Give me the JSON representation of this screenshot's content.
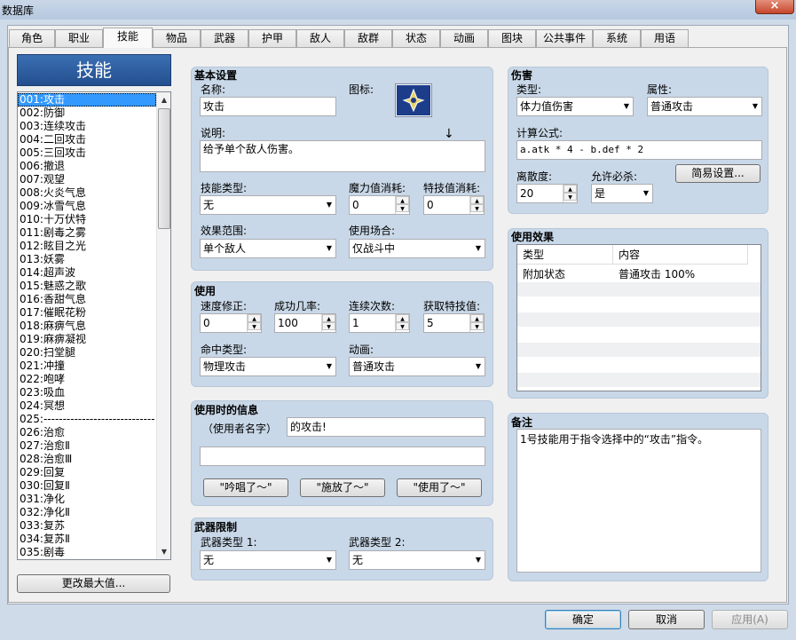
{
  "window": {
    "title": "数据库",
    "close": "×"
  },
  "tabs": [
    {
      "label": "角色"
    },
    {
      "label": "职业"
    },
    {
      "label": "技能"
    },
    {
      "label": "物品"
    },
    {
      "label": "武器"
    },
    {
      "label": "护甲"
    },
    {
      "label": "敌人"
    },
    {
      "label": "敌群"
    },
    {
      "label": "状态"
    },
    {
      "label": "动画"
    },
    {
      "label": "图块"
    },
    {
      "label": "公共事件"
    },
    {
      "label": "系统"
    },
    {
      "label": "用语"
    }
  ],
  "list": {
    "header": "技能",
    "change_max": "更改最大值...",
    "items": [
      "001:攻击",
      "002:防御",
      "003:连续攻击",
      "004:二回攻击",
      "005:三回攻击",
      "006:撤退",
      "007:观望",
      "008:火炎气息",
      "009:冰雪气息",
      "010:十万伏特",
      "011:剧毒之雾",
      "012:眩目之光",
      "013:妖雾",
      "014:超声波",
      "015:魅惑之歌",
      "016:香甜气息",
      "017:催眠花粉",
      "018:麻痹气息",
      "019:麻痹凝视",
      "020:扫堂腿",
      "021:冲撞",
      "022:咆哮",
      "023:吸血",
      "024:冥想",
      "025:-----------------------------",
      "026:治愈",
      "027:治愈Ⅱ",
      "028:治愈Ⅲ",
      "029:回复",
      "030:回复Ⅱ",
      "031:净化",
      "032:净化Ⅱ",
      "033:复苏",
      "034:复苏Ⅱ",
      "035:剧毒"
    ]
  },
  "basic": {
    "title": "基本设置",
    "name_label": "名称:",
    "name": "攻击",
    "icon_label": "图标:",
    "desc_label": "说明:",
    "desc": "给予单个敌人伤害。",
    "type_label": "技能类型:",
    "type": "无",
    "mp_label": "魔力值消耗:",
    "mp": "0",
    "tp_label": "特技值消耗:",
    "tp": "0",
    "scope_label": "效果范围:",
    "scope": "单个敌人",
    "occasion_label": "使用场合:",
    "occasion": "仅战斗中"
  },
  "invocation": {
    "title": "使用",
    "speed_label": "速度修正:",
    "speed": "0",
    "success_label": "成功几率:",
    "success": "100",
    "repeat_label": "连续次数:",
    "repeat": "1",
    "tpgain_label": "获取特技值:",
    "tpgain": "5",
    "hit_label": "命中类型:",
    "hit": "物理攻击",
    "anim_label": "动画:",
    "anim": "普通攻击"
  },
  "message": {
    "title": "使用时的信息",
    "user_label": "（使用者名字）",
    "msg1": "的攻击!",
    "msg2": "",
    "btn1": "\"吟唱了～\"",
    "btn2": "\"施放了～\"",
    "btn3": "\"使用了～\""
  },
  "weapon": {
    "title": "武器限制",
    "w1_label": "武器类型 1:",
    "w1": "无",
    "w2_label": "武器类型 2:",
    "w2": "无"
  },
  "damage": {
    "title": "伤害",
    "type_label": "类型:",
    "type": "体力值伤害",
    "element_label": "属性:",
    "element": "普通攻击",
    "formula_label": "计算公式:",
    "formula": "a.atk * 4 - b.def * 2",
    "variance_label": "离散度:",
    "variance": "20",
    "critical_label": "允许必杀:",
    "critical": "是",
    "easy": "简易设置..."
  },
  "effects": {
    "title": "使用效果",
    "col_type": "类型",
    "col_content": "内容",
    "rows": [
      {
        "type": "附加状态",
        "content": "普通攻击 100%"
      }
    ]
  },
  "note": {
    "title": "备注",
    "text": "1号技能用于指令选择中的“攻击”指令。"
  },
  "footer": {
    "ok": "确定",
    "cancel": "取消",
    "apply": "应用(A)"
  }
}
